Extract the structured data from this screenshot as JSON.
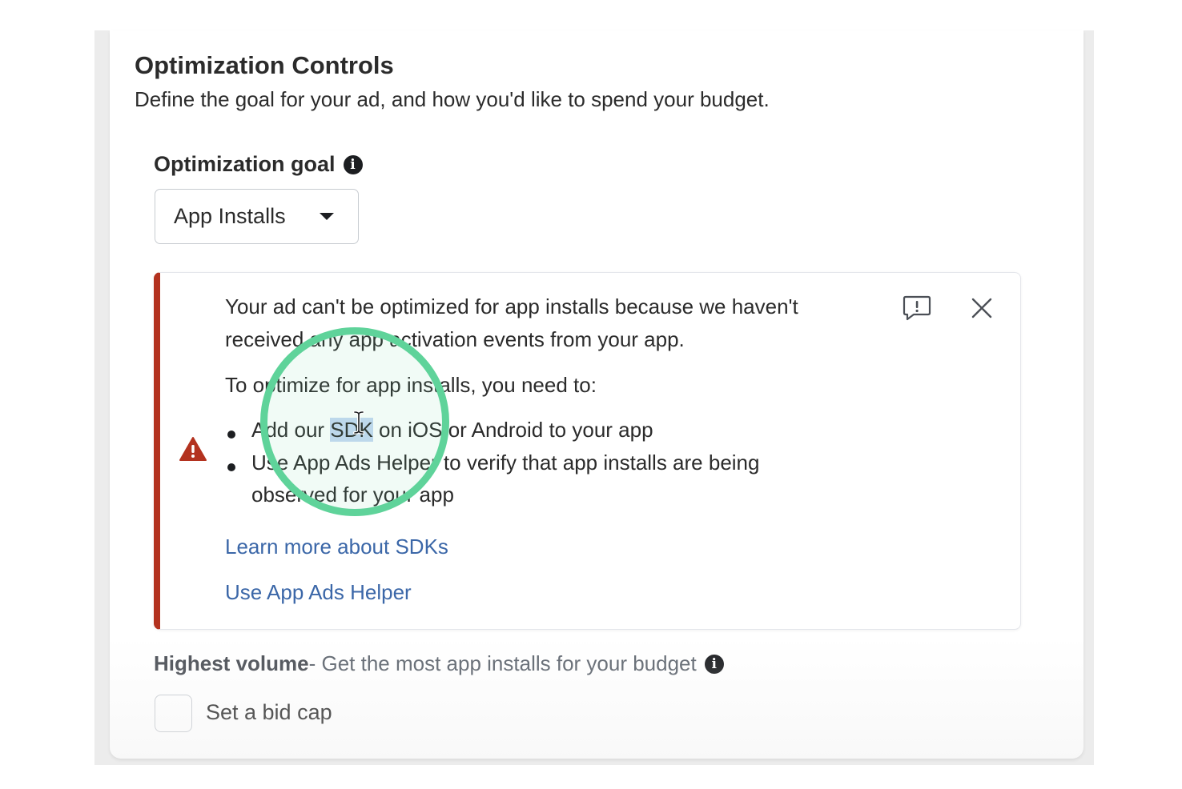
{
  "section": {
    "title": "Optimization Controls",
    "subtitle": "Define the goal for your ad, and how you'd like to spend your budget."
  },
  "optimization_goal": {
    "label": "Optimization goal",
    "info_icon": "i",
    "selected_value": "App Installs"
  },
  "alert": {
    "line1": "Your ad can't be optimized for app installs because we haven't",
    "line2": "received any app activation events from your app.",
    "intro": "To optimize for app installs, you need to:",
    "bullets": {
      "b1_before": "Add our ",
      "b1_highlight": "SDK",
      "b1_after": " on iOS or Android to your app",
      "b2_line1": "Use App Ads Helper to verify that app installs are being",
      "b2_line2": "observed for your app"
    },
    "link1": "Learn more about SDKs",
    "link2": "Use App Ads Helper",
    "icons": [
      "warning-triangle-icon",
      "feedback-icon",
      "close-icon"
    ],
    "accent_color": "#b3321f"
  },
  "bid_strategy": {
    "name": "Highest volume",
    "description": " - Get the most app installs for your budget",
    "info_icon": "i"
  },
  "bid_cap": {
    "label": "Set a bid cap",
    "checked": false
  },
  "colors": {
    "link": "#3b67a8",
    "click_indicator": "#5fd39a",
    "text_highlight": "#c6d9f3"
  }
}
